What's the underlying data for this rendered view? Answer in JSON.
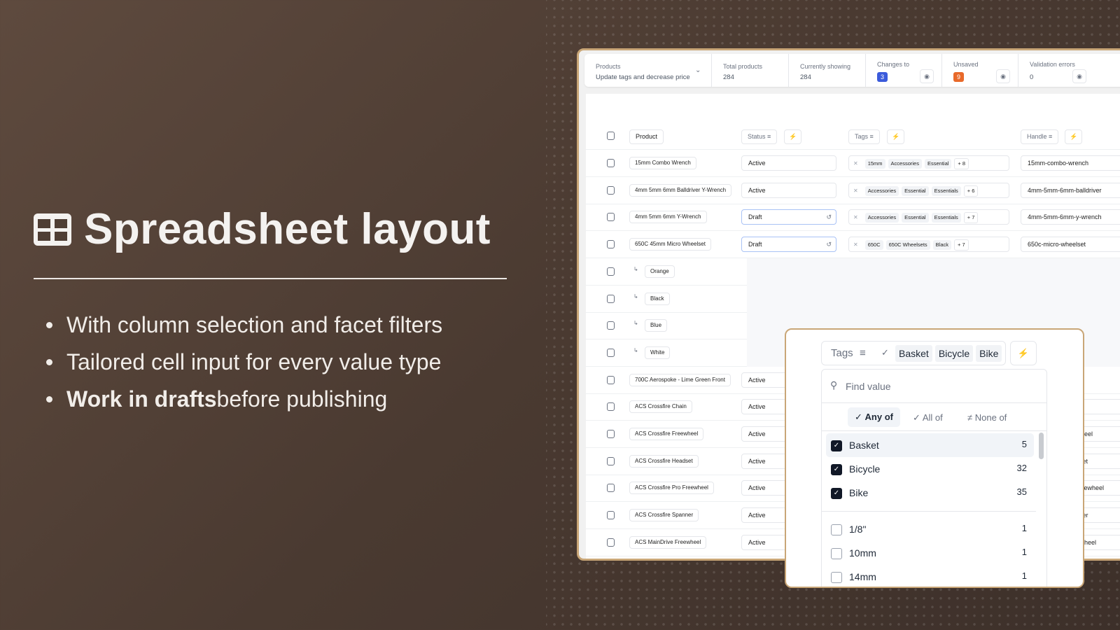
{
  "hero": {
    "title": "Spreadsheet layout",
    "bullets": [
      {
        "bold": "",
        "text": "With column selection and facet filters"
      },
      {
        "bold": "",
        "text": "Tailored cell input for every value type"
      },
      {
        "bold": "Work in drafts",
        "text": " before publishing"
      }
    ]
  },
  "stats": {
    "products_label": "Products",
    "products_value": "Update tags and decrease price",
    "total_label": "Total products",
    "total_value": "284",
    "showing_label": "Currently showing",
    "showing_value": "284",
    "changes_label": "Changes to",
    "changes_value": "3",
    "unsaved_label": "Unsaved",
    "unsaved_value": "9",
    "errors_label": "Validation errors",
    "errors_value": "0"
  },
  "colors": {
    "changes": "#3b5bdb",
    "unsaved": "#e8692a",
    "frame": "#c9a677"
  },
  "table": {
    "headers": {
      "product": "Product",
      "status": "Status",
      "tags": "Tags",
      "handle": "Handle"
    },
    "rows": [
      {
        "product": "15mm Combo Wrench",
        "status": "Active",
        "tags": [
          "15mm",
          "Accessories",
          "Essential"
        ],
        "more": "+ 8",
        "handle": "15mm-combo-wrench"
      },
      {
        "product": "4mm 5mm 6mm Balldriver Y-Wrench",
        "status": "Active",
        "tags": [
          "Accessories",
          "Essential",
          "Essentials"
        ],
        "more": "+ 6",
        "handle": "4mm-5mm-6mm-balldriver"
      },
      {
        "product": "4mm 5mm 6mm Y-Wrench",
        "status": "Draft",
        "tags": [
          "Accessories",
          "Essential",
          "Essentials"
        ],
        "more": "+ 7",
        "handle": "4mm-5mm-6mm-y-wrench"
      },
      {
        "product": "650C 45mm Micro Wheelset",
        "status": "Draft",
        "tags": [
          "650C",
          "650C Wheelsets",
          "Black"
        ],
        "more": "+ 7",
        "handle": "650c-micro-wheelset"
      },
      {
        "variant": "Orange"
      },
      {
        "variant": "Black"
      },
      {
        "variant": "Blue"
      },
      {
        "variant": "White"
      },
      {
        "product": "700C Aerospoke - Lime Green Front",
        "status": "Active"
      },
      {
        "product": "ACS Crossfire Chain",
        "status": "Active",
        "handle": "acs-crossfire-chain"
      },
      {
        "product": "ACS Crossfire Freewheel",
        "status": "Active",
        "handle": "acs-crossfire-freewheel"
      },
      {
        "product": "ACS Crossfire Headset",
        "status": "Active",
        "handle": "acs-crossfire-headset"
      },
      {
        "product": "ACS Crossfire Pro Freewheel",
        "status": "Active",
        "handle": "acs-crossfire-pro-freewheel"
      },
      {
        "product": "ACS Crossfire Spanner",
        "status": "Active",
        "handle": "acs-crossfire-spanner"
      },
      {
        "product": "ACS MainDrive Freewheel",
        "status": "Active",
        "handle": "acs-maindrive-freewheel"
      }
    ]
  },
  "filter": {
    "column": "Tags",
    "selected": [
      "Basket",
      "Bicycle",
      "Bike"
    ],
    "search_placeholder": "Find value",
    "modes": [
      {
        "label": "Any of",
        "active": true
      },
      {
        "label": "All of"
      },
      {
        "label": "None of"
      }
    ],
    "options": [
      {
        "label": "Basket",
        "count": "5",
        "checked": true
      },
      {
        "label": "Bicycle",
        "count": "32",
        "checked": true
      },
      {
        "label": "Bike",
        "count": "35",
        "checked": true
      },
      {
        "label": "1/8\"",
        "count": "1"
      },
      {
        "label": "10mm",
        "count": "1"
      },
      {
        "label": "14mm",
        "count": "1"
      }
    ]
  }
}
